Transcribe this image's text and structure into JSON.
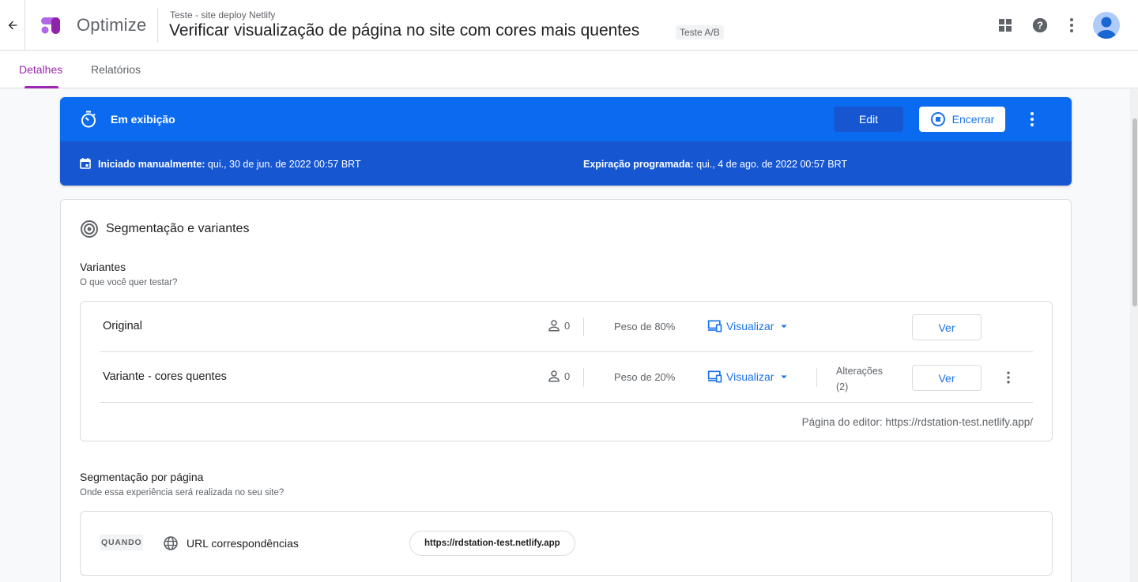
{
  "header": {
    "app_name": "Optimize",
    "container_name": "Teste - site deploy Netlify",
    "experiment_title": "Verificar visualização de página no site com cores mais quentes",
    "experiment_type": "Teste A/B",
    "icons": [
      "arrow-back-icon",
      "apps-grid-icon",
      "help-icon",
      "more-vert-icon",
      "account-avatar"
    ]
  },
  "tabs": [
    {
      "label": "Detalhes",
      "active": true
    },
    {
      "label": "Relatórios",
      "active": false
    }
  ],
  "status": {
    "state_label": "Em exibição",
    "edit_label": "Edit",
    "end_label": "Encerrar",
    "start_label": "Iniciado manualmente:",
    "start_value": " qui., 30 de jun. de 2022 00:57 BRT",
    "expiry_label": "Expiração programada:",
    "expiry_value": " qui., 4 de ago. de 2022 00:57 BRT"
  },
  "targeting": {
    "title": "Segmentação e variantes",
    "variants_title": "Variantes",
    "variants_subtitle": "O que você quer testar?",
    "variants": [
      {
        "name": "Original",
        "visitors": "0",
        "weight": "Peso de 80%",
        "preview_label": "Visualizar",
        "view_label": "Ver"
      },
      {
        "name": "Variante - cores quentes",
        "visitors": "0",
        "weight": "Peso de 20%",
        "preview_label": "Visualizar",
        "changes_label": "Alterações",
        "changes_count": "(2)",
        "view_label": "Ver"
      }
    ],
    "editor_page": "Página do editor: https://rdstation-test.netlify.app/",
    "page_targeting_title": "Segmentação por página",
    "page_targeting_subtitle": "Onde essa experiência será realizada no seu site?",
    "rule": {
      "when_label": "QUANDO",
      "url_label": "URL correspondências",
      "url_value": "https://rdstation-test.netlify.app"
    }
  },
  "colors": {
    "brand_purple": "#9c27b0",
    "status_blue": "#0b6bf0",
    "status_blue_dark": "#1657d1",
    "link_blue": "#1a73e8"
  }
}
